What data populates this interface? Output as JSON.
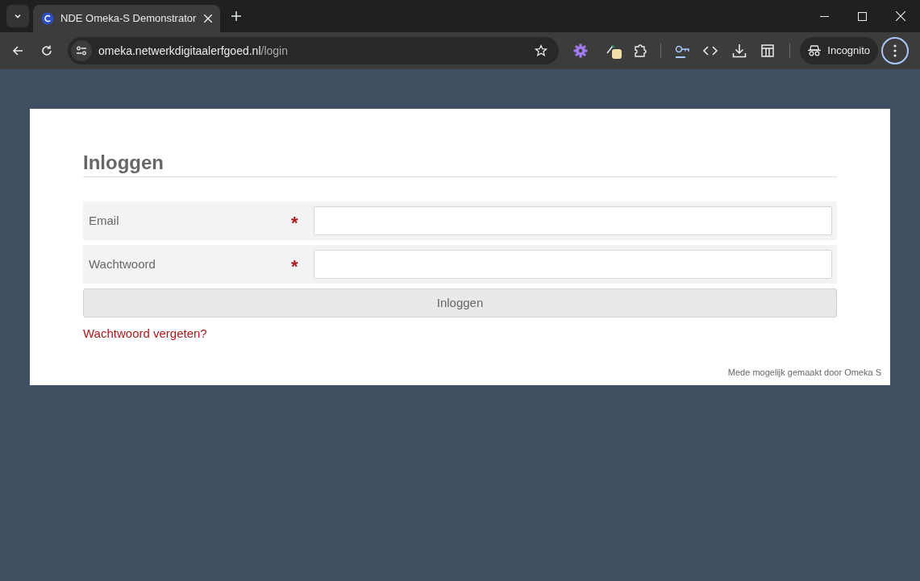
{
  "browser": {
    "tabs": [
      {
        "title": "NDE Omeka-S Demonstrator",
        "selected": true
      }
    ],
    "url": {
      "host": "omeka.netwerkdigitaalerfgoed.nl",
      "path": "/login"
    },
    "profile_label": "Incognito"
  },
  "page": {
    "heading": "Inloggen",
    "fields": [
      {
        "label": "Email",
        "required": true,
        "marker": "*"
      },
      {
        "label": "Wachtwoord",
        "required": true,
        "marker": "*"
      }
    ],
    "submit": "Inloggen",
    "forgot_link": "Wachtwoord vergeten?",
    "footer": "Mede mogelijk gemaakt door Omeka S"
  }
}
